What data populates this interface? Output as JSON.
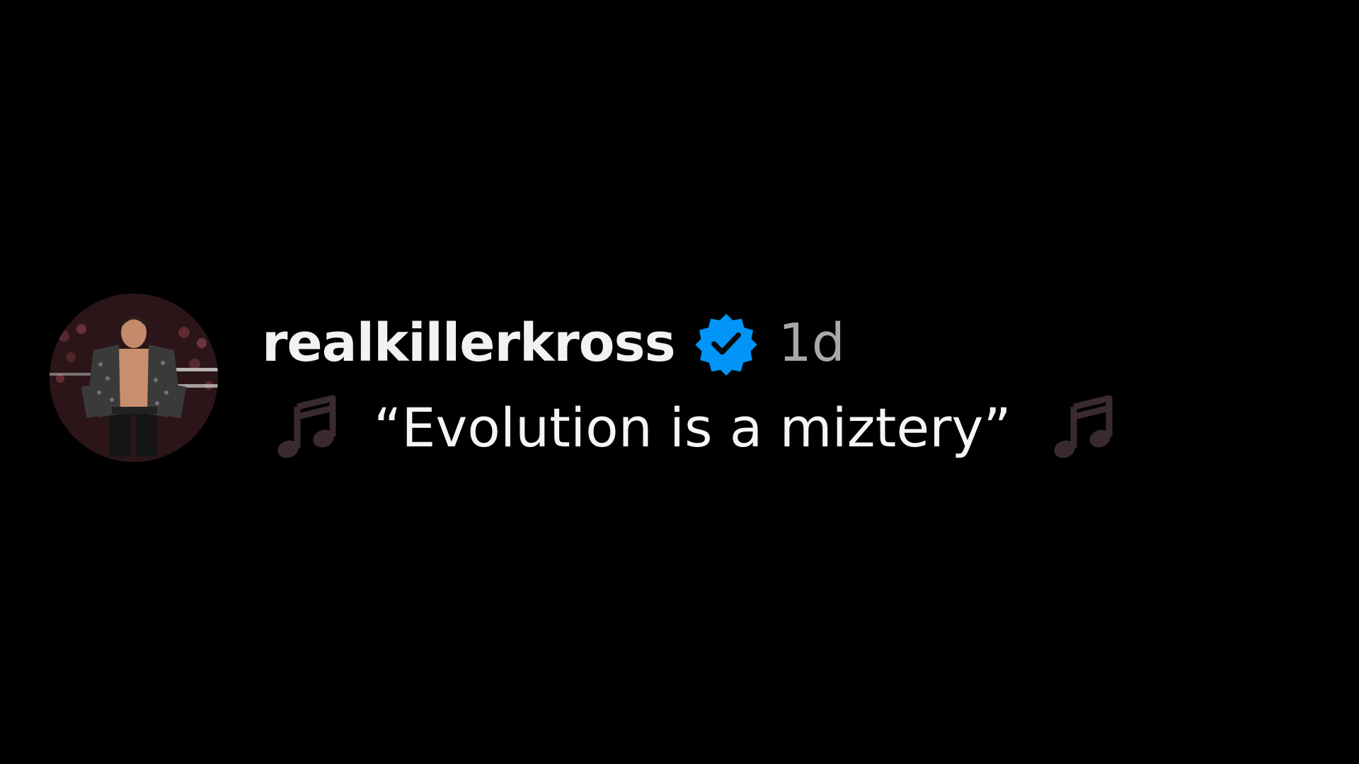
{
  "comment": {
    "username": "realkillerkross",
    "verified": true,
    "timestamp": "1d",
    "text": "“Evolution is a miztery”",
    "icons": {
      "avatar": "profile-photo",
      "verified": "verified-badge-icon",
      "leading_emoji": "musical-notes-icon",
      "trailing_emoji": "musical-notes-icon"
    },
    "colors": {
      "background": "#000000",
      "username": "#f2f2f2",
      "timestamp": "#a8a8a8",
      "verified_badge": "#0095f6",
      "music_notes": "#3a2a2e"
    }
  }
}
